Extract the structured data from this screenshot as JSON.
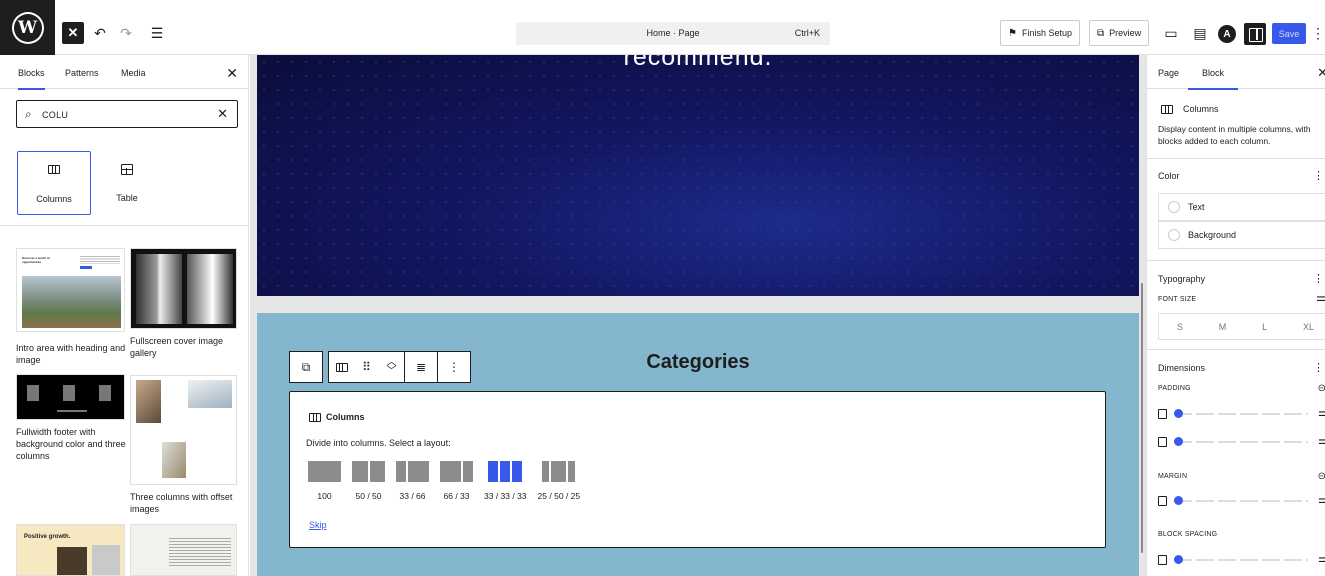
{
  "topbar": {
    "wp_logo": "W",
    "command_title": "Home · Page",
    "command_shortcut": "Ctrl+K",
    "finish_setup": "Finish Setup",
    "preview": "Preview",
    "save": "Save",
    "astra_logo": "A"
  },
  "inserter": {
    "tabs": [
      "Blocks",
      "Patterns",
      "Media"
    ],
    "search_value": "COLU",
    "results": [
      {
        "label": "Columns",
        "icon": "columns-icon"
      },
      {
        "label": "Table",
        "icon": "table-icon"
      }
    ],
    "patterns": [
      {
        "label": "Intro area with heading and image",
        "thumb_text": "Discover a world of opportunities"
      },
      {
        "label": "Fullscreen cover image gallery"
      },
      {
        "label": "Fullwidth footer with background color and three columns"
      },
      {
        "label": "Three columns with offset images"
      },
      {
        "label": "",
        "thumb_text": "Positive growth."
      },
      {
        "label": ""
      }
    ]
  },
  "canvas": {
    "hero_heading": "recommend.",
    "categories_heading": "Categories",
    "placeholder": {
      "title": "Columns",
      "instructions": "Divide into columns. Select a layout:",
      "layouts": [
        {
          "label": "100",
          "parts": [
            1
          ]
        },
        {
          "label": "50 / 50",
          "parts": [
            1,
            1
          ]
        },
        {
          "label": "33 / 66",
          "parts": [
            1,
            2
          ]
        },
        {
          "label": "66 / 33",
          "parts": [
            2,
            1
          ]
        },
        {
          "label": "33 / 33 / 33",
          "parts": [
            1,
            1,
            1
          ],
          "selected": true
        },
        {
          "label": "25 / 50 / 25",
          "parts": [
            1,
            2,
            1
          ]
        }
      ],
      "skip": "Skip"
    }
  },
  "settings": {
    "tabs": [
      "Page",
      "Block"
    ],
    "active_tab": "Block",
    "block_name": "Columns",
    "block_description": "Display content in multiple columns, with blocks added to each column.",
    "color": {
      "heading": "Color",
      "items": [
        "Text",
        "Background"
      ]
    },
    "typography": {
      "heading": "Typography",
      "font_size_label": "FONT SIZE",
      "sizes": [
        "S",
        "M",
        "L",
        "XL"
      ]
    },
    "dimensions": {
      "heading": "Dimensions",
      "padding_label": "PADDING",
      "margin_label": "MARGIN",
      "block_spacing_label": "BLOCK SPACING"
    }
  },
  "colors": {
    "accent": "#3858e9",
    "hero": "#121660",
    "categories_bg": "#84b7ce"
  }
}
